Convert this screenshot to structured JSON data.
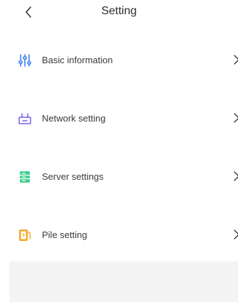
{
  "header": {
    "title": "Setting",
    "back_icon": "chevron-left-icon"
  },
  "menu": [
    {
      "label": "Basic information",
      "icon": "sliders-icon",
      "color": "#3b82f6"
    },
    {
      "label": "Network setting",
      "icon": "router-icon",
      "color": "#7c5cf0"
    },
    {
      "label": "Server settings",
      "icon": "server-icon",
      "color": "#3ecf8e"
    },
    {
      "label": "Pile setting",
      "icon": "charging-pile-icon",
      "color": "#f5a623"
    }
  ]
}
